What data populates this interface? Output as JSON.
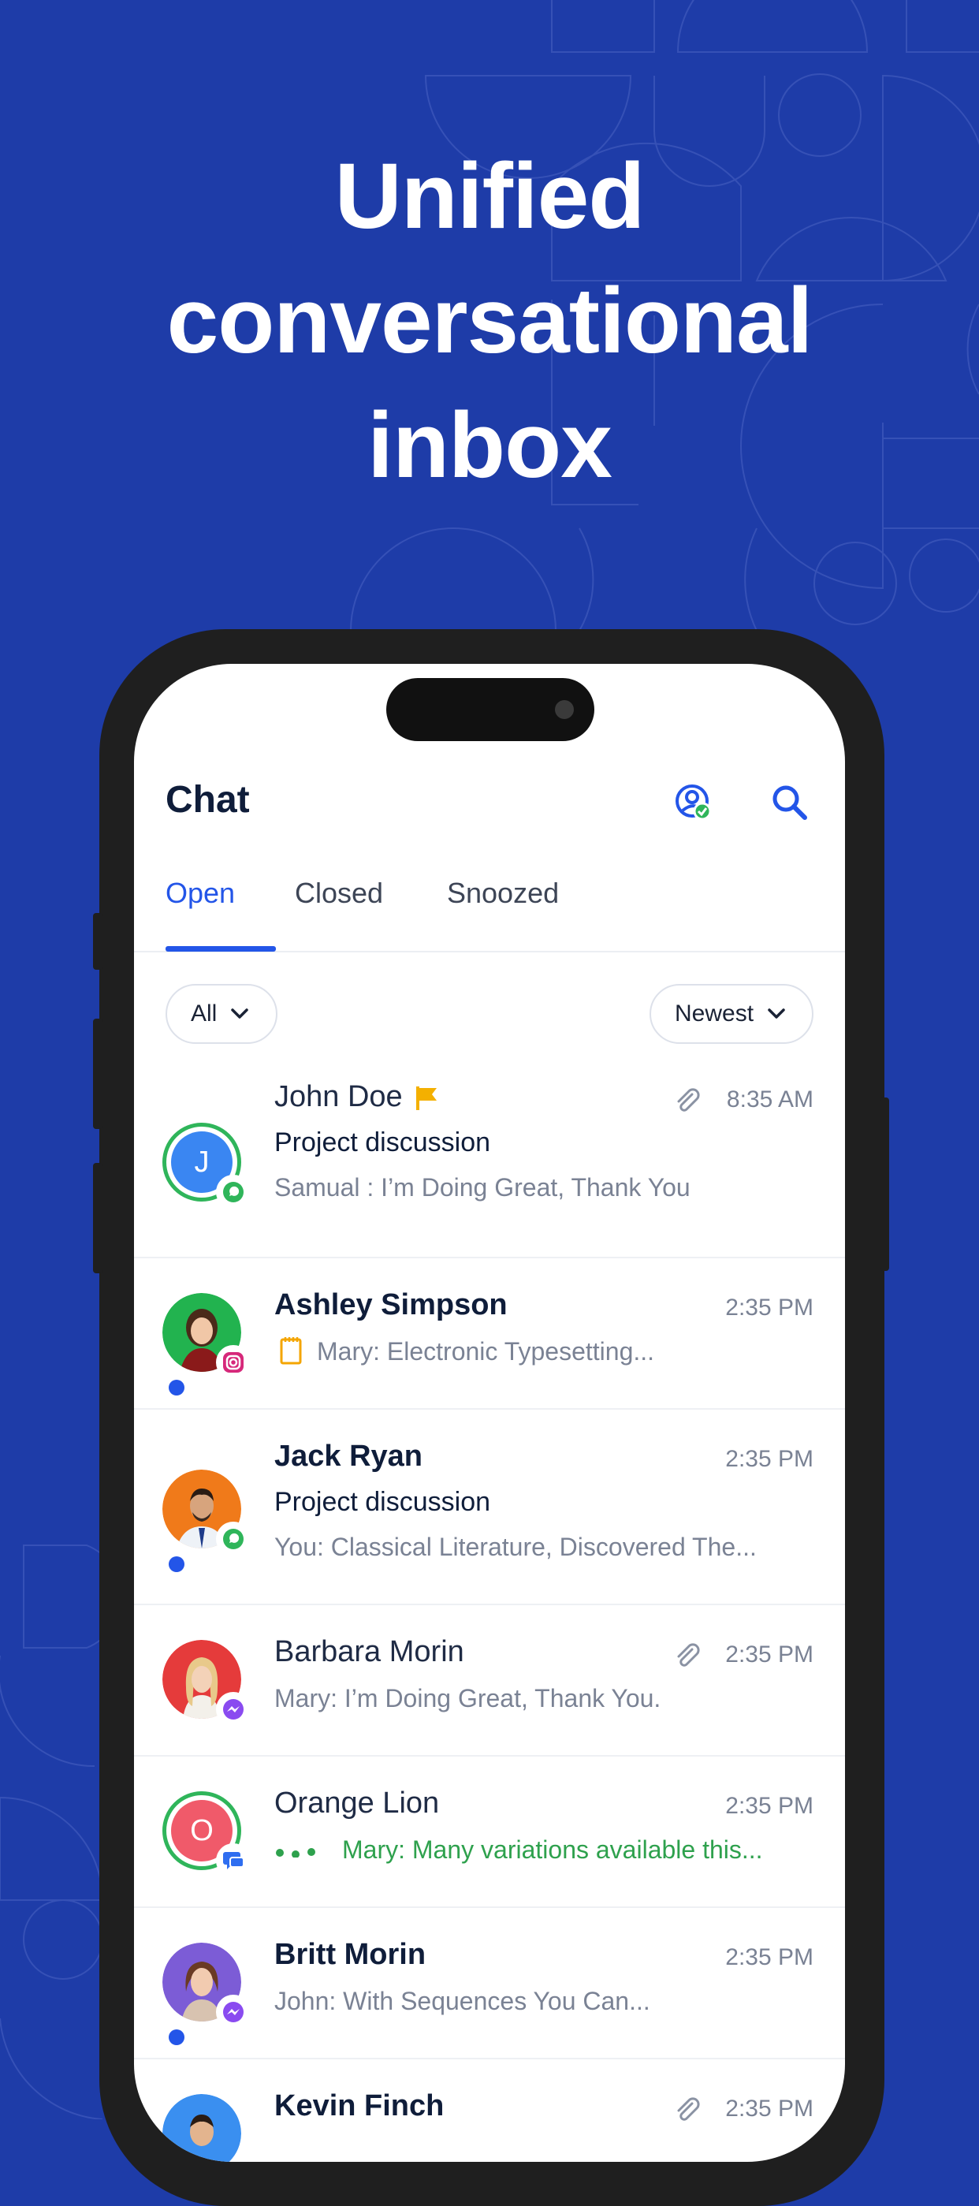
{
  "hero": {
    "line1": "Unified",
    "line2": "conversational",
    "line3": "inbox"
  },
  "header": {
    "title": "Chat"
  },
  "tabs": [
    {
      "label": "Open"
    },
    {
      "label": "Closed"
    },
    {
      "label": "Snoozed"
    }
  ],
  "filters": {
    "left": "All",
    "right": "Newest"
  },
  "colors": {
    "background": "#1e3ca8",
    "accent": "#2355e8",
    "online_ring": "#2fb55a",
    "typing": "#2ea14d",
    "flag": "#f4b000"
  },
  "conversations": [
    {
      "name": "John Doe",
      "initial": "J",
      "time": "8:35 AM",
      "subject": "Project discussion",
      "preview": "Samual : I’m Doing Great, Thank You",
      "channel": "whatsapp-icon",
      "flagged": true,
      "attachment": true
    },
    {
      "name": "Ashley Simpson",
      "time": "2:35 PM",
      "preview": "Mary: Electronic Typesetting...",
      "channel": "instagram-icon",
      "note": true,
      "unread": true
    },
    {
      "name": "Jack Ryan",
      "time": "2:35 PM",
      "subject": "Project discussion",
      "preview": "You: Classical Literature, Discovered The...",
      "channel": "whatsapp-icon",
      "unread": true
    },
    {
      "name": "Barbara Morin",
      "time": "2:35 PM",
      "preview": "Mary:  I’m Doing Great, Thank You.",
      "channel": "messenger-icon",
      "attachment": true
    },
    {
      "name": "Orange Lion",
      "initial": "O",
      "time": "2:35 PM",
      "preview": "Mary: Many variations available this...",
      "channel": "chat-icon",
      "typing": true
    },
    {
      "name": "Britt Morin",
      "time": "2:35 PM",
      "preview": "John: With Sequences You Can...",
      "channel": "messenger-icon",
      "unread": true
    },
    {
      "name": "Kevin Finch",
      "time": "2:35 PM",
      "attachment": true
    }
  ]
}
